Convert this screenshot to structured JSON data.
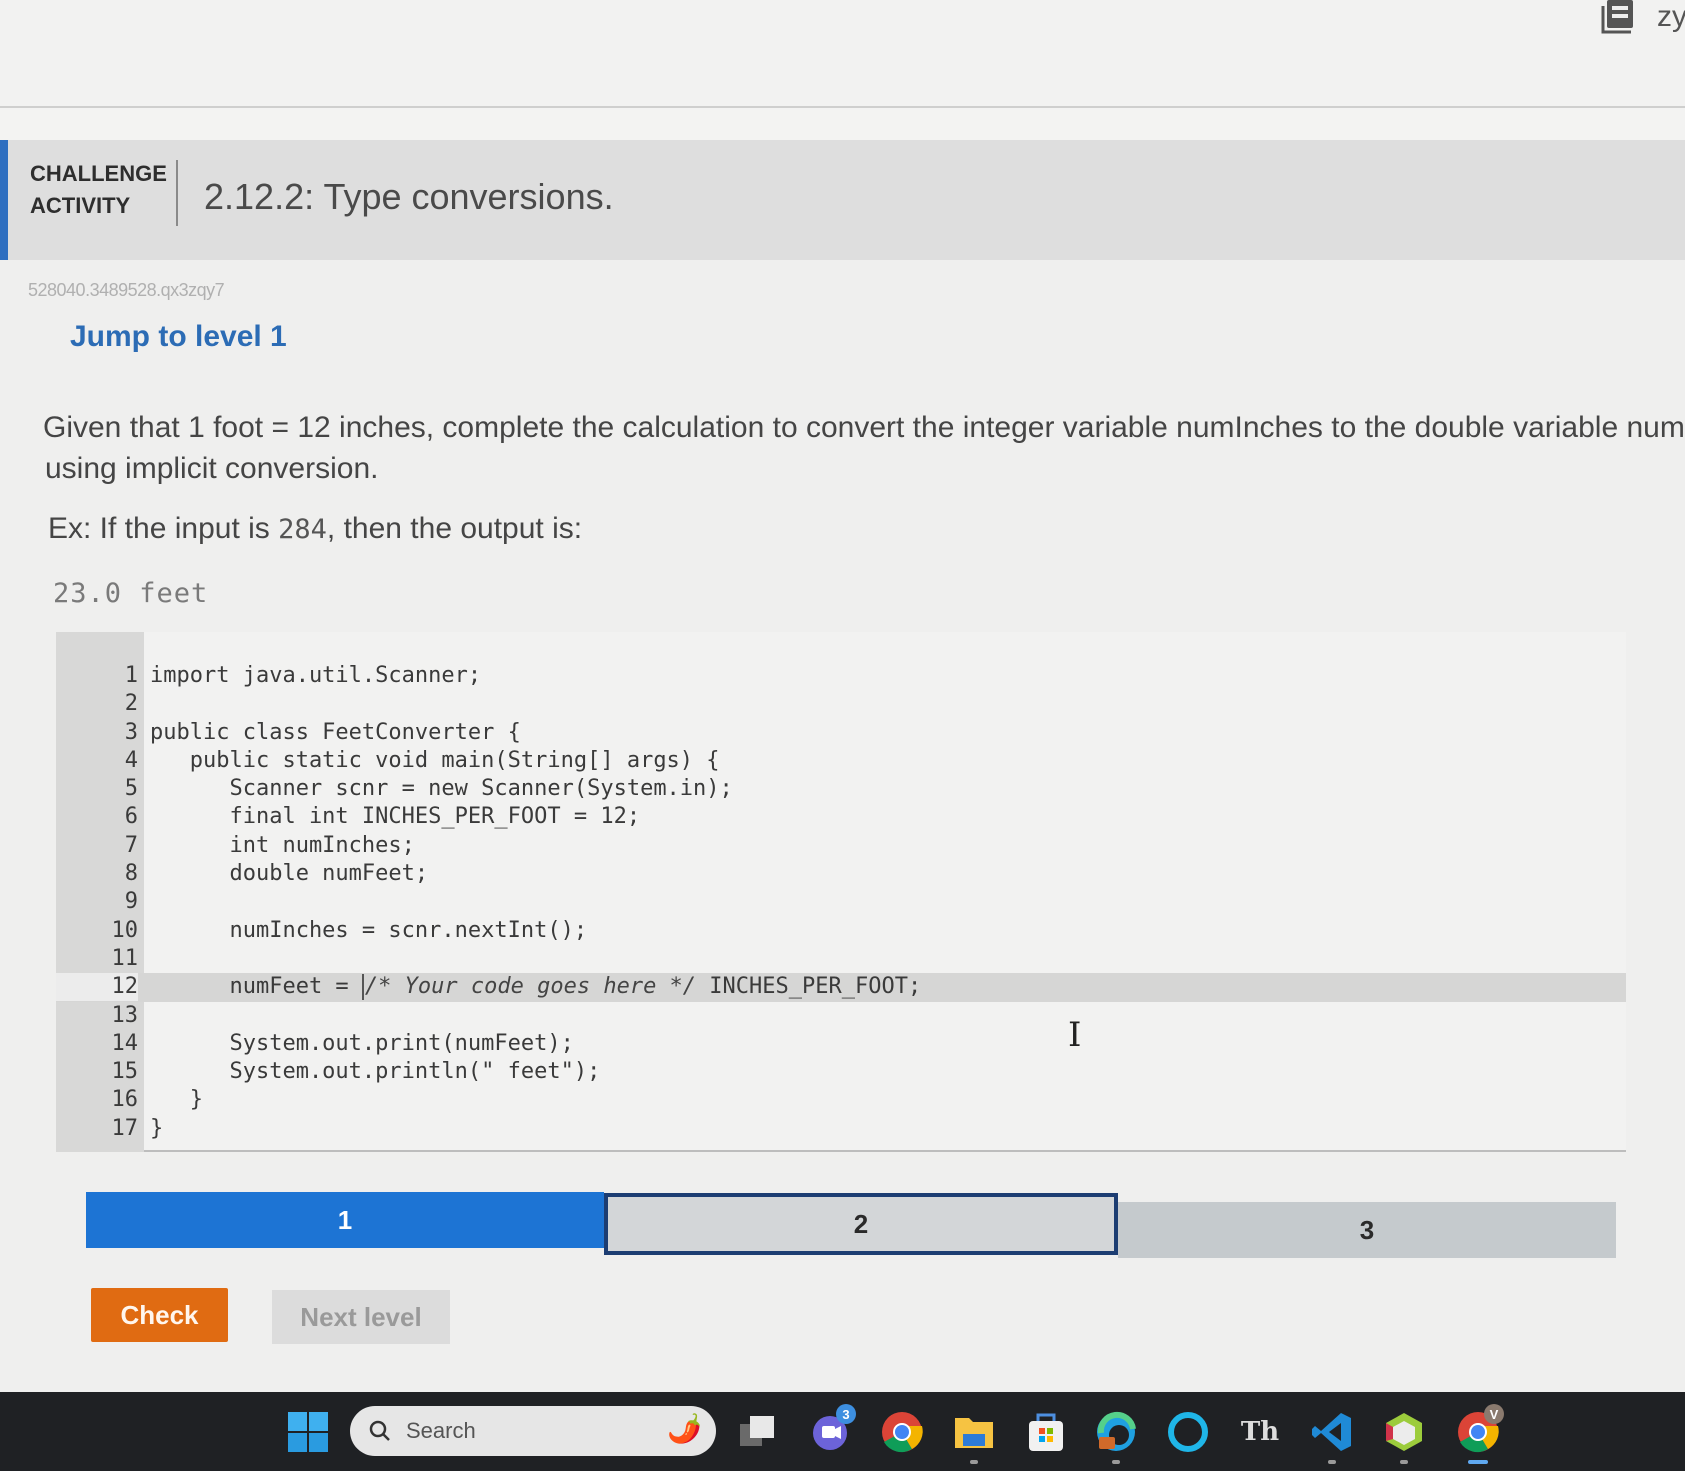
{
  "app": {
    "brand_text": "zy"
  },
  "challenge": {
    "label_line1": "CHALLENGE",
    "label_line2": "ACTIVITY",
    "title": "2.12.2: Type conversions.",
    "activity_id": "528040.3489528.qx3zqy7",
    "jump_link": "Jump to level 1"
  },
  "prompt": {
    "line1": "Given that 1 foot = 12 inches, complete the calculation to convert the integer variable numInches to the double variable numFee",
    "line2": "using implicit conversion.",
    "example_prefix": "Ex: If the input is ",
    "example_input": "284",
    "example_suffix": ", then the output is:",
    "example_output": "23.0 feet"
  },
  "editor": {
    "active_line": 12,
    "lines": [
      {
        "num": "1",
        "code": "import java.util.Scanner;"
      },
      {
        "num": "2",
        "code": ""
      },
      {
        "num": "3",
        "code": "public class FeetConverter {"
      },
      {
        "num": "4",
        "code": "   public static void main(String[] args) {"
      },
      {
        "num": "5",
        "code": "      Scanner scnr = new Scanner(System.in);"
      },
      {
        "num": "6",
        "code": "      final int INCHES_PER_FOOT = 12;"
      },
      {
        "num": "7",
        "code": "      int numInches;"
      },
      {
        "num": "8",
        "code": "      double numFeet;"
      },
      {
        "num": "9",
        "code": ""
      },
      {
        "num": "10",
        "code": "      numInches = scnr.nextInt();"
      },
      {
        "num": "11",
        "code": ""
      },
      {
        "num": "12",
        "code_before": "      numFeet = ",
        "comment": "/* Your code goes here */",
        "code_after": " INCHES_PER_FOOT;"
      },
      {
        "num": "13",
        "code": ""
      },
      {
        "num": "14",
        "code": "      System.out.print(numFeet);"
      },
      {
        "num": "15",
        "code": "      System.out.println(\" feet\");"
      },
      {
        "num": "16",
        "code": "   }"
      },
      {
        "num": "17",
        "code": "}"
      }
    ]
  },
  "levels": {
    "current": 1,
    "selected": 2,
    "items": [
      {
        "label": "1"
      },
      {
        "label": "2"
      },
      {
        "label": "3"
      }
    ]
  },
  "buttons": {
    "check": "Check",
    "next_level": "Next level"
  },
  "taskbar": {
    "search_placeholder": "Search",
    "teams_badge": "3",
    "profile_badge": "V",
    "apps": [
      "start",
      "search",
      "task-view",
      "teams",
      "chrome",
      "file-explorer",
      "microsoft-store",
      "edge",
      "alexa",
      "typora",
      "vscode",
      "app-cube",
      "chrome-profile"
    ]
  },
  "colors": {
    "level_active": "#1d74d4",
    "level_selected_border": "#1c3d72",
    "check_button": "#e06b12",
    "link": "#2c6cb5",
    "challenge_accent": "#2f6fc0"
  }
}
